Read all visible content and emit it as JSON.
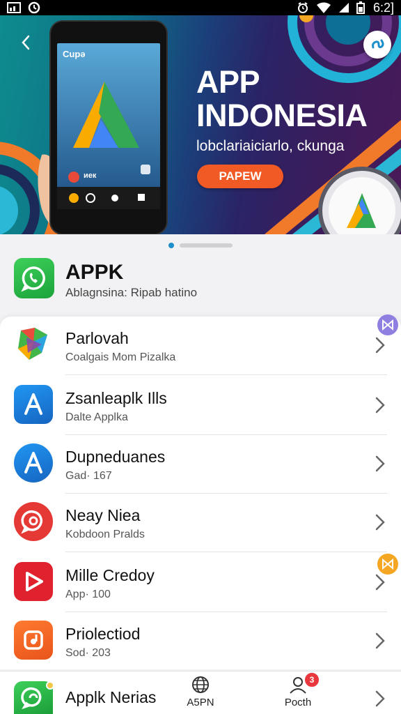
{
  "status_bar": {
    "time": "6:2]"
  },
  "banner": {
    "title": "APP\nINDONESIA",
    "subtitle": "lobclariaiciarlo, ckunga",
    "button_label": "PAPEW",
    "phone_screen_text": "Cupə",
    "phone_widget_text": "иек",
    "colors": {
      "accent_orange": "#f15a24",
      "teal": "#0e8c8e",
      "purple": "#4a1a58"
    }
  },
  "pager": {
    "active_index": 0
  },
  "app_header": {
    "title": "APPK",
    "subtitle": "Ablagnsina: Ripab hatino",
    "icon": "chat-bubble-phone-icon"
  },
  "list": [
    {
      "title": "Parlovah",
      "subtitle": "Coalgais Mom Pizalka",
      "icon": "colorful-play-icon"
    },
    {
      "title": "Zsanleaplk Ills",
      "subtitle": "Dalte Applka",
      "icon": "app-store-icon"
    },
    {
      "title": "Dupneduanes",
      "subtitle": "Gad· 167",
      "icon": "app-store-circle-icon"
    },
    {
      "title": "Neay Niea",
      "subtitle": "Kobdoon Pralds",
      "icon": "red-chat-icon"
    },
    {
      "title": "Mille Credoy",
      "subtitle": "App· 100",
      "icon": "red-play-icon"
    },
    {
      "title": "Priolectiod",
      "subtitle": "Sod· 203",
      "icon": "orange-app-icon"
    }
  ],
  "bottom_bar": {
    "app_label": "Applk Nerias",
    "tabs": [
      {
        "label": "A5PN",
        "icon": "globe-icon"
      },
      {
        "label": "Pocth",
        "icon": "person-icon"
      }
    ],
    "notification_count": "3"
  }
}
